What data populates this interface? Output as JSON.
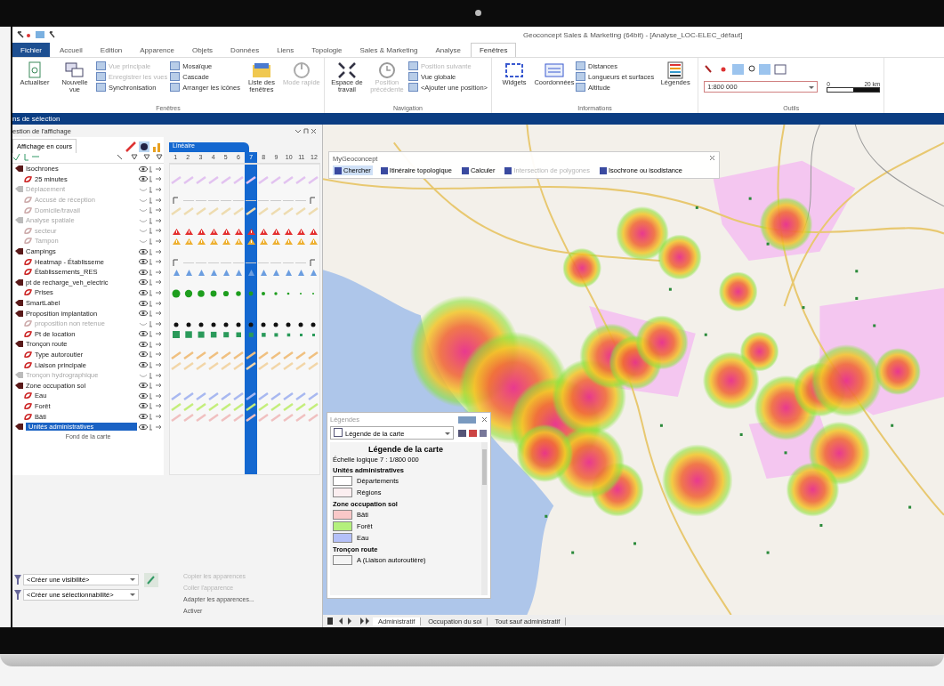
{
  "window": {
    "title": "Geoconcept Sales & Marketing (64bit) - [Analyse_LOC-ELEC_défaut]"
  },
  "ribbon_tabs": [
    {
      "label": "Fichier",
      "kind": "file",
      "selected": false
    },
    {
      "label": "Accueil",
      "kind": "tab",
      "selected": false
    },
    {
      "label": "Edition",
      "kind": "tab",
      "selected": false
    },
    {
      "label": "Apparence",
      "kind": "tab",
      "selected": false
    },
    {
      "label": "Objets",
      "kind": "tab",
      "selected": false
    },
    {
      "label": "Données",
      "kind": "tab",
      "selected": false
    },
    {
      "label": "Liens",
      "kind": "tab",
      "selected": false
    },
    {
      "label": "Topologie",
      "kind": "tab",
      "selected": false
    },
    {
      "label": "Sales & Marketing",
      "kind": "tab",
      "selected": false
    },
    {
      "label": "Analyse",
      "kind": "tab",
      "selected": false
    },
    {
      "label": "Fenêtres",
      "kind": "tab",
      "selected": true
    }
  ],
  "ribbon_groups": [
    {
      "label": "Fenêtres",
      "items": [
        {
          "kind": "doc",
          "label": "Actualiser",
          "disabled": false
        },
        {
          "kind": "windows",
          "label": "Nouvelle vue",
          "disabled": false
        },
        {
          "kind": "small",
          "lines": [
            {
              "label": "Vue principale",
              "disabled": true
            },
            {
              "label": "Enregistrer les vues",
              "disabled": true
            },
            {
              "label": "Synchronisation",
              "disabled": false
            }
          ]
        },
        {
          "kind": "small",
          "lines": [
            {
              "label": "Mosaïque",
              "disabled": false
            },
            {
              "label": "Cascade",
              "disabled": false
            },
            {
              "label": "Arranger les icônes",
              "disabled": false
            }
          ]
        },
        {
          "kind": "folder",
          "label": "Liste des fenêtres",
          "disabled": false
        },
        {
          "kind": "power",
          "label": "Mode rapide",
          "disabled": true
        }
      ]
    },
    {
      "label": "Navigation",
      "items": [
        {
          "kind": "expand",
          "label": "Espace de travail",
          "disabled": false
        },
        {
          "kind": "clock",
          "label": "Position précédente",
          "disabled": true
        },
        {
          "kind": "small",
          "lines": [
            {
              "label": "Position suivante",
              "disabled": true
            },
            {
              "label": "Vue globale",
              "disabled": false
            },
            {
              "label": "<Ajouter une position>",
              "disabled": false
            }
          ]
        }
      ]
    },
    {
      "label": "Informations",
      "items": [
        {
          "kind": "widgets",
          "label": "Widgets",
          "disabled": false
        },
        {
          "kind": "xyz",
          "label": "Coordonnées",
          "disabled": false
        },
        {
          "kind": "small",
          "lines": [
            {
              "label": "Distances",
              "disabled": false
            },
            {
              "label": "Longueurs et surfaces",
              "disabled": false
            },
            {
              "label": "Altitude",
              "disabled": false
            }
          ]
        },
        {
          "kind": "legend",
          "label": "Légendes",
          "disabled": false
        }
      ]
    },
    {
      "label": "Outils",
      "items": [
        {
          "kind": "scale",
          "label": "1:800 000",
          "start": "0",
          "end": "20 km"
        }
      ]
    }
  ],
  "selection_bar": {
    "title": "ns de sélection"
  },
  "display_panel": {
    "title": "estion de l'affichage",
    "tab": "Affichage en cours",
    "timeline_title": "Linéaire",
    "footer": "Fond de la carte",
    "columns": [
      {
        "label": "1",
        "selected": false
      },
      {
        "label": "2",
        "selected": false
      },
      {
        "label": "3",
        "selected": false
      },
      {
        "label": "4",
        "selected": false
      },
      {
        "label": "5",
        "selected": false
      },
      {
        "label": "6",
        "selected": false
      },
      {
        "label": "7",
        "selected": true
      },
      {
        "label": "8",
        "selected": false
      },
      {
        "label": "9",
        "selected": false
      },
      {
        "label": "10",
        "selected": false
      },
      {
        "label": "11",
        "selected": false
      },
      {
        "label": "12",
        "selected": false
      }
    ],
    "layers": [
      {
        "label": "Isochrones",
        "visible": true,
        "selected": false,
        "children": [
          {
            "label": "25 minutes",
            "visible": true,
            "selected": false,
            "kind": "hatch",
            "color": "#e2c2f0"
          }
        ]
      },
      {
        "label": "Déplacement",
        "visible": false,
        "selected": false,
        "children": [
          {
            "label": "Accusé de réception",
            "visible": false,
            "selected": false,
            "kind": "line"
          },
          {
            "label": "Domicile/travail",
            "visible": false,
            "selected": false,
            "kind": "hatch",
            "color": "#eedcb0"
          }
        ]
      },
      {
        "label": "Analyse spatiale",
        "visible": false,
        "selected": false,
        "children": [
          {
            "label": "secteur",
            "visible": false,
            "selected": false,
            "kind": "signs",
            "color": "#e43030"
          },
          {
            "label": "Tampon",
            "visible": false,
            "selected": false,
            "kind": "signs",
            "color": "#eeb030"
          }
        ]
      },
      {
        "label": "Campings",
        "visible": true,
        "selected": false,
        "children": [
          {
            "label": "Heatmap - Établisseme",
            "visible": true,
            "selected": false,
            "kind": "line"
          },
          {
            "label": "Établissements_RES",
            "visible": true,
            "selected": false,
            "kind": "triangles",
            "color": "#6c9ee0"
          }
        ]
      },
      {
        "label": "pt de recharge_veh_electric",
        "visible": true,
        "selected": false,
        "children": [
          {
            "label": "Prises",
            "visible": true,
            "selected": false,
            "kind": "dots",
            "color": "#1e9e1e"
          }
        ]
      },
      {
        "label": "SmartLabel",
        "visible": true,
        "selected": false
      },
      {
        "label": "Proposition implantation",
        "visible": true,
        "selected": false,
        "children": [
          {
            "label": "proposition non retenue",
            "visible": false,
            "selected": false,
            "kind": "blackdots",
            "color": "#111111"
          },
          {
            "label": "Pt de location",
            "visible": true,
            "selected": false,
            "kind": "squares",
            "color": "#2a9a5a"
          }
        ]
      },
      {
        "label": "Tronçon route",
        "visible": true,
        "selected": false,
        "children": [
          {
            "label": "Type autoroutier",
            "visible": true,
            "selected": false,
            "kind": "hatch",
            "color": "#f0c080"
          },
          {
            "label": "Liaison principale",
            "visible": true,
            "selected": false,
            "kind": "hatch",
            "color": "#f2d6a8"
          }
        ]
      },
      {
        "label": "Tronçon hydrographique",
        "visible": false,
        "selected": false
      },
      {
        "label": "Zone occupation sol",
        "visible": true,
        "selected": false,
        "children": [
          {
            "label": "Eau",
            "visible": true,
            "selected": false,
            "kind": "hatch",
            "color": "#a8b8f0"
          },
          {
            "label": "Forêt",
            "visible": true,
            "selected": false,
            "kind": "hatch",
            "color": "#c4ee7c"
          },
          {
            "label": "Bâti",
            "visible": true,
            "selected": false,
            "kind": "hatch",
            "color": "#f0c0c0"
          }
        ]
      },
      {
        "label": "Unités administratives",
        "visible": true,
        "selected": true
      }
    ],
    "visibility_fields": [
      {
        "value": "<Créer une visibilité>"
      },
      {
        "value": "<Créer une sélectionnabilité>"
      }
    ],
    "actions": [
      {
        "label": "Copier les apparences",
        "disabled": true
      },
      {
        "label": "Coller l'apparence",
        "disabled": true
      },
      {
        "label": "Adapter les apparences...",
        "disabled": false
      },
      {
        "label": "Activer",
        "disabled": false
      }
    ]
  },
  "toolbar_widget": {
    "title": "MyGeoconcept",
    "buttons": [
      {
        "label": "Chercher",
        "selected": true,
        "disabled": false
      },
      {
        "label": "Itinéraire topologique",
        "selected": false,
        "disabled": false
      },
      {
        "label": "Calculer",
        "selected": false,
        "disabled": false
      },
      {
        "label": "Intersection de polygones",
        "selected": false,
        "disabled": true
      },
      {
        "label": "Isochrone ou isodistance",
        "selected": false,
        "disabled": false
      }
    ]
  },
  "legend_window": {
    "title": "Légendes",
    "dropdown": "Légende de la carte",
    "heading": "Légende de la carte",
    "scale": "Échelle logique 7 : 1/800 000",
    "sections": [
      {
        "title": "Unités administratives",
        "items": [
          {
            "label": "Départements",
            "color": "#ffffff"
          },
          {
            "label": "Régions",
            "color": "#fbeef0"
          }
        ]
      },
      {
        "title": "Zone occupation sol",
        "items": [
          {
            "label": "Bâti",
            "color": "#f9c8c8"
          },
          {
            "label": "Forêt",
            "color": "#b4f07c"
          },
          {
            "label": "Eau",
            "color": "#b4c0f8"
          }
        ]
      },
      {
        "title": "Tronçon route",
        "items": [
          {
            "label": "A (Liaison autoroutière)",
            "color": "#f4f4f4"
          }
        ]
      }
    ]
  },
  "map_tabs": [
    {
      "label": "Administratif",
      "selected": true
    },
    {
      "label": "Occupation du sol",
      "selected": false
    },
    {
      "label": "Tout sauf administratif",
      "selected": false
    }
  ]
}
